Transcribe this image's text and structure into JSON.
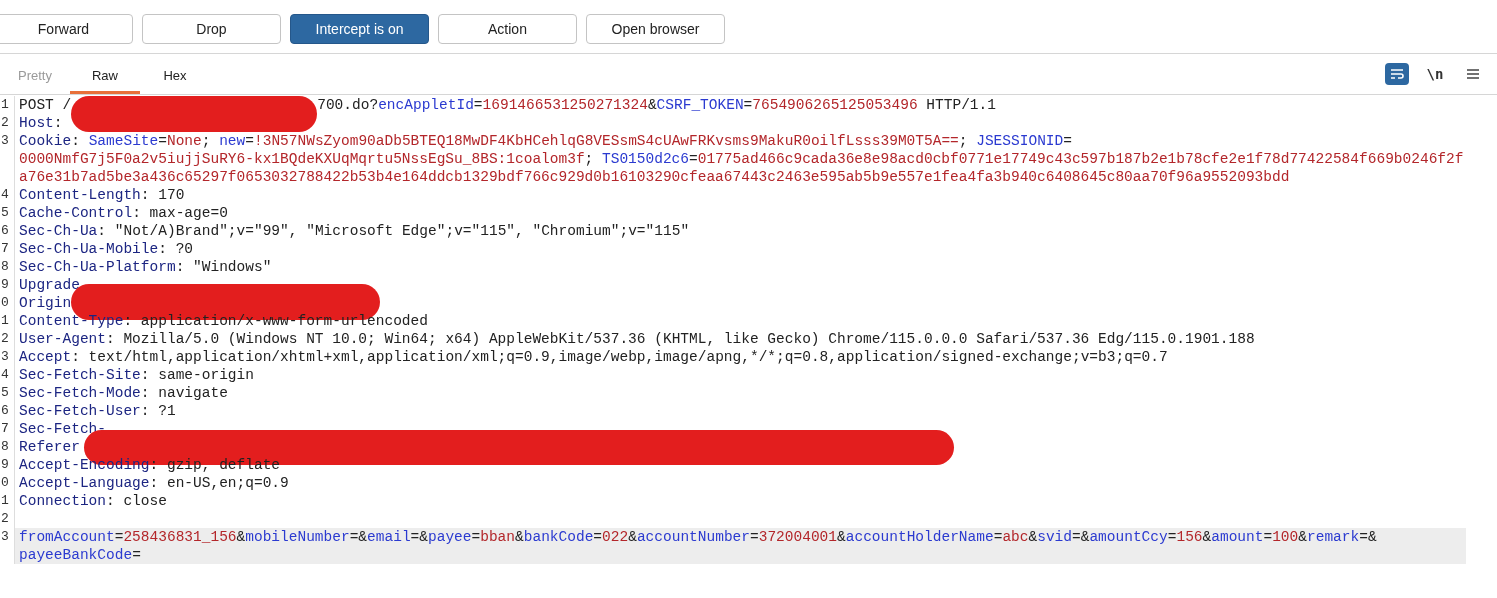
{
  "toolbar": {
    "buttons": [
      {
        "label": "Forward",
        "selected": false
      },
      {
        "label": "Drop",
        "selected": false
      },
      {
        "label": "Intercept is on",
        "selected": true
      },
      {
        "label": "Action",
        "selected": false
      },
      {
        "label": "Open browser",
        "selected": false
      }
    ]
  },
  "tabs": [
    {
      "label": "Pretty",
      "selected": false,
      "disabled": true
    },
    {
      "label": "Raw",
      "selected": true,
      "disabled": false
    },
    {
      "label": "Hex",
      "selected": false,
      "disabled": false
    }
  ],
  "view_toggles": [
    {
      "kind": "wrap",
      "on": true
    },
    {
      "kind": "text",
      "label": "\\n",
      "on": false
    },
    {
      "kind": "menu"
    }
  ],
  "editor": {
    "lines": [
      {
        "n": "1",
        "segs": [
          {
            "kind": "plain",
            "text": "POST /"
          },
          {
            "kind": "redaction"
          },
          {
            "kind": "plain",
            "text": "700.do?"
          },
          {
            "kind": "param",
            "text": "encAppletId"
          },
          {
            "kind": "plain",
            "text": "="
          },
          {
            "kind": "value",
            "text": "1691466531250271324"
          },
          {
            "kind": "plain",
            "text": "&"
          },
          {
            "kind": "param",
            "text": "CSRF_TOKEN"
          },
          {
            "kind": "plain",
            "text": "="
          },
          {
            "kind": "value",
            "text": "7654906265125053496"
          },
          {
            "kind": "plain",
            "text": " HTTP/1.1"
          }
        ]
      },
      {
        "n": "2",
        "segs": [
          {
            "kind": "header",
            "text": "Host"
          },
          {
            "kind": "plain",
            "text": ":"
          }
        ]
      },
      {
        "n": "3",
        "segs": [
          {
            "kind": "header",
            "text": "Cookie"
          },
          {
            "kind": "plain",
            "text": ": "
          },
          {
            "kind": "param",
            "text": "SameSite"
          },
          {
            "kind": "plain",
            "text": "="
          },
          {
            "kind": "value",
            "text": "None"
          },
          {
            "kind": "plain",
            "text": "; "
          },
          {
            "kind": "param",
            "text": "new"
          },
          {
            "kind": "plain",
            "text": "="
          },
          {
            "kind": "value",
            "text": "!3N57NWsZyom90aDb5BTEQ18MwDF4KbHCehlqG8VESsmS4cUAwFRKvsms9MakuR0oilfLsss39M0T5A=="
          },
          {
            "kind": "plain",
            "text": "; "
          },
          {
            "kind": "param",
            "text": "JSESSIONID"
          },
          {
            "kind": "plain",
            "text": "="
          },
          {
            "kind": "value",
            "text": "0000NmfG7j5F0a2v5iujjSuRY6-kx1BQdeKXUqMqrtu5NssEgSu_8BS:1coalom3f"
          },
          {
            "kind": "plain",
            "text": "; "
          },
          {
            "kind": "param",
            "text": "TS0150d2c6"
          },
          {
            "kind": "plain",
            "text": "="
          },
          {
            "kind": "value",
            "text": "01775ad466c9cada36e8e98acd0cbf0771e17749c43c597b187b2e1b78cfe2e1f78d77422584f669b0246f2fa76e31b7ad5be3a436c65297f0653032788422b53b4e164ddcb1329bdf766c929d0b16103290cfeaa67443c2463e595ab5b9e557e1fea4fa3b940c6408645c80aa70f96a9552093bdd"
          }
        ]
      },
      {
        "n": "4",
        "segs": [
          {
            "kind": "header",
            "text": "Content-Length"
          },
          {
            "kind": "plain",
            "text": ": 170"
          }
        ]
      },
      {
        "n": "5",
        "segs": [
          {
            "kind": "header",
            "text": "Cache-Control"
          },
          {
            "kind": "plain",
            "text": ": max-age=0"
          }
        ]
      },
      {
        "n": "6",
        "segs": [
          {
            "kind": "header",
            "text": "Sec-Ch-Ua"
          },
          {
            "kind": "plain",
            "text": ": \"Not/A)Brand\";v=\"99\", \"Microsoft Edge\";v=\"115\", \"Chromium\";v=\"115\""
          }
        ]
      },
      {
        "n": "7",
        "segs": [
          {
            "kind": "header",
            "text": "Sec-Ch-Ua-Mobile"
          },
          {
            "kind": "plain",
            "text": ": ?0"
          }
        ]
      },
      {
        "n": "8",
        "segs": [
          {
            "kind": "header",
            "text": "Sec-Ch-Ua-Platform"
          },
          {
            "kind": "plain",
            "text": ": \"Windows\""
          }
        ]
      },
      {
        "n": "9",
        "segs": [
          {
            "kind": "header",
            "text": "Upgrade"
          }
        ]
      },
      {
        "n": "0",
        "segs": [
          {
            "kind": "header",
            "text": "Origin"
          },
          {
            "kind": "redaction"
          }
        ]
      },
      {
        "n": "1",
        "segs": [
          {
            "kind": "header",
            "text": "Content-Type"
          },
          {
            "kind": "plain",
            "text": ": application/x-www-form-urlencoded"
          }
        ]
      },
      {
        "n": "2",
        "segs": [
          {
            "kind": "header",
            "text": "User-Agent"
          },
          {
            "kind": "plain",
            "text": ": Mozilla/5.0 (Windows NT 10.0; Win64; x64) AppleWebKit/537.36 (KHTML, like Gecko) Chrome/115.0.0.0 Safari/537.36 Edg/115.0.1901.188"
          }
        ]
      },
      {
        "n": "3",
        "segs": [
          {
            "kind": "header",
            "text": "Accept"
          },
          {
            "kind": "plain",
            "text": ": text/html,application/xhtml+xml,application/xml;q=0.9,image/webp,image/apng,*/*;q=0.8,application/signed-exchange;v=b3;q=0.7"
          }
        ]
      },
      {
        "n": "4",
        "segs": [
          {
            "kind": "header",
            "text": "Sec-Fetch-Site"
          },
          {
            "kind": "plain",
            "text": ": same-origin"
          }
        ]
      },
      {
        "n": "5",
        "segs": [
          {
            "kind": "header",
            "text": "Sec-Fetch-Mode"
          },
          {
            "kind": "plain",
            "text": ": navigate"
          }
        ]
      },
      {
        "n": "6",
        "segs": [
          {
            "kind": "header",
            "text": "Sec-Fetch-User"
          },
          {
            "kind": "plain",
            "text": ": ?1"
          }
        ]
      },
      {
        "n": "7",
        "segs": [
          {
            "kind": "header",
            "text": "Sec-Fetch-"
          }
        ]
      },
      {
        "n": "8",
        "segs": [
          {
            "kind": "header",
            "text": "Referer"
          },
          {
            "kind": "redaction"
          }
        ]
      },
      {
        "n": "9",
        "segs": [
          {
            "kind": "header",
            "text": "Accept-Encoding"
          },
          {
            "kind": "plain",
            "text": ": gzip, deflate"
          }
        ]
      },
      {
        "n": "0",
        "segs": [
          {
            "kind": "header",
            "text": "Accept-Language"
          },
          {
            "kind": "plain",
            "text": ": en-US,en;q=0.9"
          }
        ]
      },
      {
        "n": "1",
        "segs": [
          {
            "kind": "header",
            "text": "Connection"
          },
          {
            "kind": "plain",
            "text": ": close"
          }
        ]
      },
      {
        "n": "2"
      },
      {
        "n": "3",
        "current": true,
        "segs": [
          {
            "kind": "param",
            "text": "fromAccount"
          },
          {
            "kind": "plain",
            "text": "="
          },
          {
            "kind": "value",
            "text": "258436831_156"
          },
          {
            "kind": "plain",
            "text": "&"
          },
          {
            "kind": "param",
            "text": "mobileNumber"
          },
          {
            "kind": "plain",
            "text": "=&"
          },
          {
            "kind": "param",
            "text": "email"
          },
          {
            "kind": "plain",
            "text": "=&"
          },
          {
            "kind": "param",
            "text": "payee"
          },
          {
            "kind": "plain",
            "text": "="
          },
          {
            "kind": "value",
            "text": "bban"
          },
          {
            "kind": "plain",
            "text": "&"
          },
          {
            "kind": "param",
            "text": "bankCode"
          },
          {
            "kind": "plain",
            "text": "="
          },
          {
            "kind": "value",
            "text": "022"
          },
          {
            "kind": "plain",
            "text": "&"
          },
          {
            "kind": "param",
            "text": "accountNumber"
          },
          {
            "kind": "plain",
            "text": "="
          },
          {
            "kind": "value",
            "text": "372004001"
          },
          {
            "kind": "plain",
            "text": "&"
          },
          {
            "kind": "param",
            "text": "accountHolderName"
          },
          {
            "kind": "plain",
            "text": "="
          },
          {
            "kind": "value",
            "text": "abc"
          },
          {
            "kind": "plain",
            "text": "&"
          },
          {
            "kind": "param",
            "text": "svid"
          },
          {
            "kind": "plain",
            "text": "=&"
          },
          {
            "kind": "param",
            "text": "amountCcy"
          },
          {
            "kind": "plain",
            "text": "="
          },
          {
            "kind": "value",
            "text": "156"
          },
          {
            "kind": "plain",
            "text": "&"
          },
          {
            "kind": "param",
            "text": "amount"
          },
          {
            "kind": "plain",
            "text": "="
          },
          {
            "kind": "value",
            "text": "100"
          },
          {
            "kind": "plain",
            "text": "&"
          },
          {
            "kind": "param",
            "text": "remark"
          },
          {
            "kind": "plain",
            "text": "=&"
          },
          {
            "kind": "param",
            "text": "payeeBankCode"
          },
          {
            "kind": "plain",
            "text": "="
          }
        ]
      }
    ]
  }
}
